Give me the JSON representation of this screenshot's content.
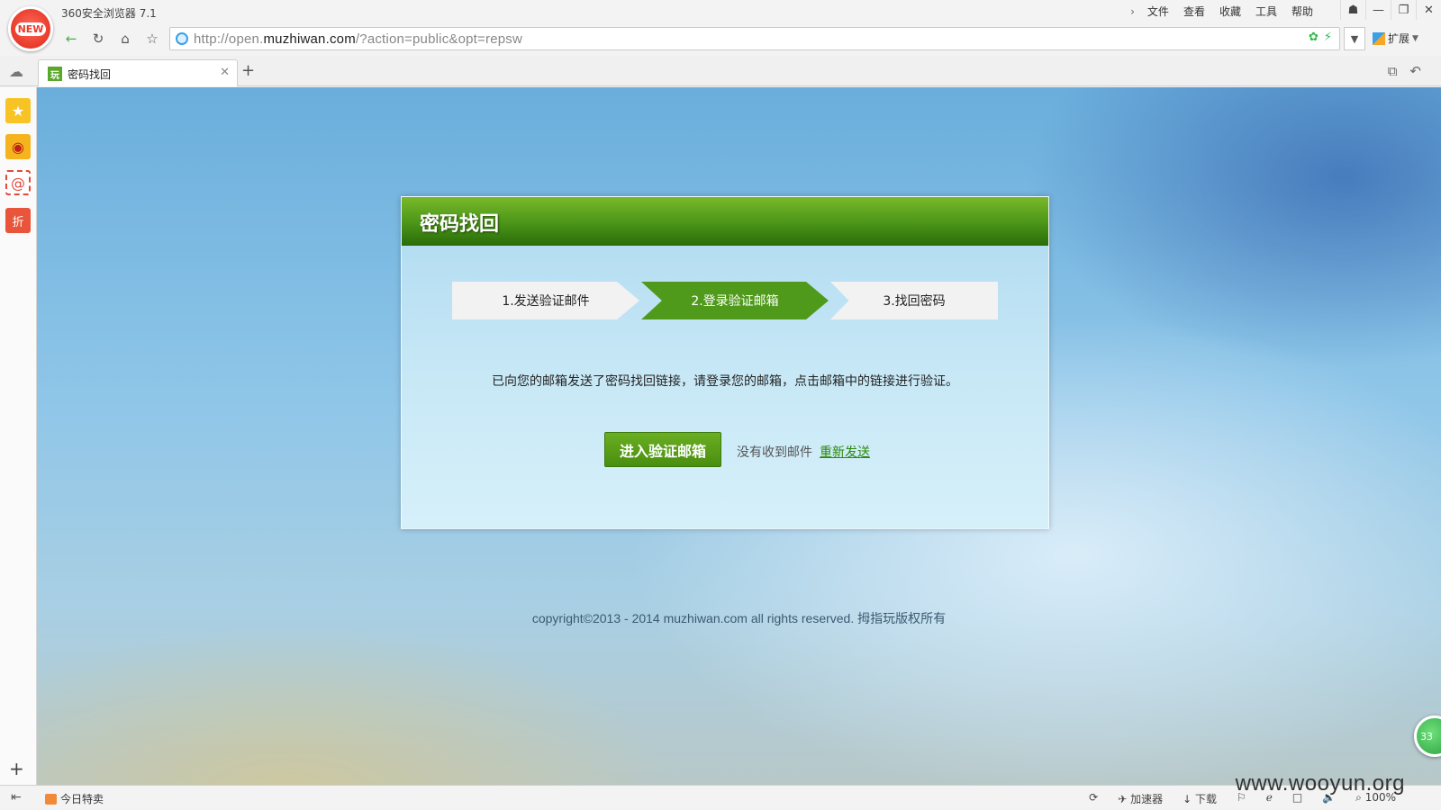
{
  "window": {
    "app_title": "360安全浏览器 7.1",
    "logo_text": "NEW",
    "menu": [
      "文件",
      "查看",
      "收藏",
      "工具",
      "帮助"
    ],
    "menu_chevron": "›"
  },
  "navbar": {
    "url_prefix": "http://open.",
    "url_host": "muzhiwan.com",
    "url_suffix": "/?action=public&opt=repsw",
    "extension_label": "扩展"
  },
  "tabs": [
    {
      "favicon_text": "玩",
      "title": "密码找回",
      "active": true
    }
  ],
  "page": {
    "card_title": "密码找回",
    "steps": [
      "1.发送验证邮件",
      "2.登录验证邮箱",
      "3.找回密码"
    ],
    "active_step": 2,
    "message": "已向您的邮箱发送了密码找回链接，请登录您的邮箱，点击邮箱中的链接进行验证。",
    "enter_button": "进入验证邮箱",
    "no_mail_text": "没有收到邮件",
    "resend_link": "重新发送",
    "copyright": "copyright©2013 - 2014 muzhiwan.com all rights reserved. 拇指玩版权所有",
    "float_badge": "33"
  },
  "statusbar": {
    "deal_label": "今日特卖",
    "accelerator": "加速器",
    "download": "下载",
    "zoom": "100%"
  },
  "watermark": "www.wooyun.org",
  "colors": {
    "header_green": "#4a9418",
    "active_step_green": "#4f9a1a",
    "button_green": "#4a8e10",
    "link_green": "#2a8a0c"
  }
}
